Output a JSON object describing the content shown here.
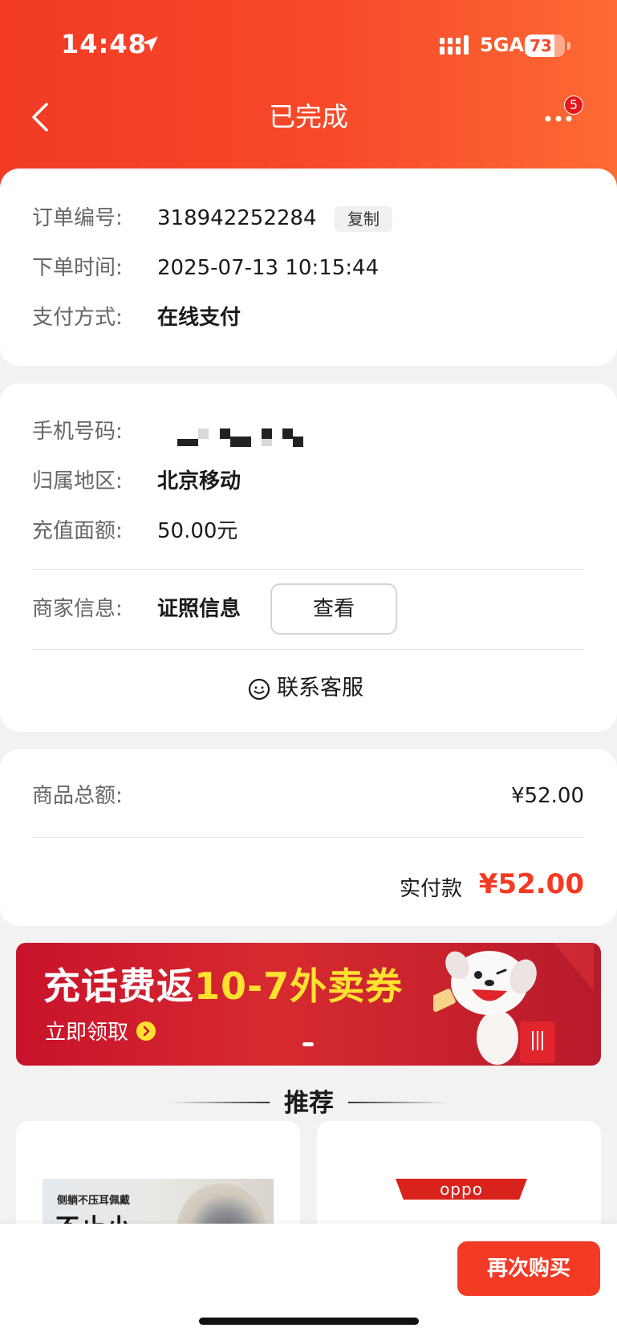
{
  "status_bar": {
    "time": "14:48",
    "network": "5GA",
    "battery": "73",
    "battery_level": 0.73
  },
  "nav": {
    "title": "已完成",
    "badge_count": "5"
  },
  "order_info": {
    "order_no_label": "订单编号:",
    "order_no": "318942252284",
    "copy_label": "复制",
    "time_label": "下单时间:",
    "time_value": "2025-07-13 10:15:44",
    "pay_label": "支付方式:",
    "pay_value": "在线支付"
  },
  "recharge_info": {
    "phone_label": "手机号码:",
    "region_label": "归属地区:",
    "region_value": "北京移动",
    "amount_label": "充值面额:",
    "amount_value": "50.00元",
    "merchant_label": "商家信息:",
    "merchant_value": "证照信息",
    "view_label": "查看",
    "contact_label": "联系客服"
  },
  "payment": {
    "total_label": "商品总额:",
    "total_value": "¥52.00",
    "paid_label": "实付款",
    "paid_value": "¥52.00"
  },
  "banner": {
    "title_white": "充话费返",
    "title_yellow": "10-7外卖券",
    "subtitle": "立即领取"
  },
  "recommend": {
    "title": "推荐",
    "product1_tag": "侧躺不压耳佩戴",
    "product1_headline": "不止小",
    "product2_brand": "oppo"
  },
  "bottom": {
    "rebuy_label": "再次购买"
  },
  "colors": {
    "accent": "#f23a25",
    "header_gradient_end": "#fd6a33",
    "banner_yellow": "#ffe230"
  }
}
